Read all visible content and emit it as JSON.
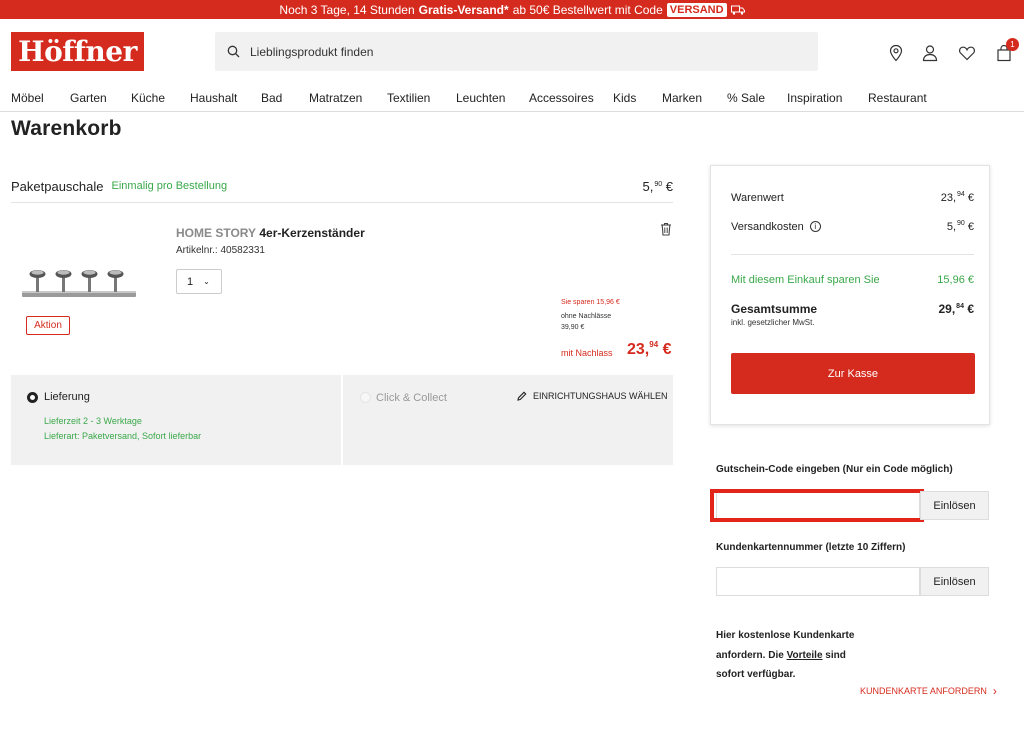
{
  "promo": {
    "text_pre": "Noch  3 Tage, 14 Stunden",
    "bold": "Gratis-Versand*",
    "text_mid": "ab 50€ Bestellwert mit Code",
    "code": "VERSAND"
  },
  "header": {
    "logo": "Höffner",
    "search_placeholder": "Lieblingsprodukt finden",
    "cart_count": "1"
  },
  "nav": [
    "Möbel",
    "Garten",
    "Küche",
    "Haushalt",
    "Bad",
    "Matratzen",
    "Textilien",
    "Leuchten",
    "Accessoires",
    "Kids",
    "Marken",
    "% Sale",
    "Inspiration",
    "Restaurant"
  ],
  "page_title": "Warenkorb",
  "paket": {
    "label": "Paketpauschale",
    "note": "Einmalig pro Bestellung",
    "price_main": "5,",
    "price_cents": "90",
    "price_cur": "€"
  },
  "product": {
    "badge": "Aktion",
    "brand": "HOME STORY",
    "name": "4er-Kerzenständer",
    "article": "Artikelnr.: 40582331",
    "qty": "1",
    "save_line": "Sie sparen  15,96 €",
    "ohne_label": "ohne Nachlässe",
    "ohne_price": "39,90 €",
    "mit_label": "mit Nachlass",
    "price_main": "23,",
    "price_cents": "94",
    "price_cur": "€"
  },
  "delivery": {
    "option1": "Lieferung",
    "lieferzeit": "Lieferzeit 2 - 3 Werktage",
    "lieferart": "Lieferart: Paketversand, Sofort lieferbar",
    "option2": "Click & Collect",
    "store_link": "EINRICHTUNGSHAUS WÄHLEN"
  },
  "summary": {
    "warenwert_label": "Warenwert",
    "warenwert_main": "23,",
    "warenwert_cents": "94",
    "versand_label": "Versandkosten",
    "versand_main": "5,",
    "versand_cents": "90",
    "spar_label": "Mit diesem Einkauf sparen Sie",
    "spar_value": "15,96 €",
    "total_label": "Gesamtsumme",
    "total_main": "29,",
    "total_cents": "84",
    "mwst": "inkl. gesetzlicher MwSt.",
    "cur": "€",
    "checkout": "Zur Kasse"
  },
  "coupon": {
    "label": "Gutschein-Code eingeben (Nur ein Code möglich)",
    "button": "Einlösen"
  },
  "kundenkarte": {
    "label": "Kundenkartennummer (letzte 10 Ziffern)",
    "button": "Einlösen",
    "promo_1": "Hier kostenlose Kundenkarte anfordern. Die",
    "promo_link": "Vorteile",
    "promo_2": "sind sofort verfügbar.",
    "link": "KUNDENKARTE ANFORDERN"
  },
  "colors": {
    "brand_red": "#d52b1e",
    "green": "#3aa84a"
  }
}
